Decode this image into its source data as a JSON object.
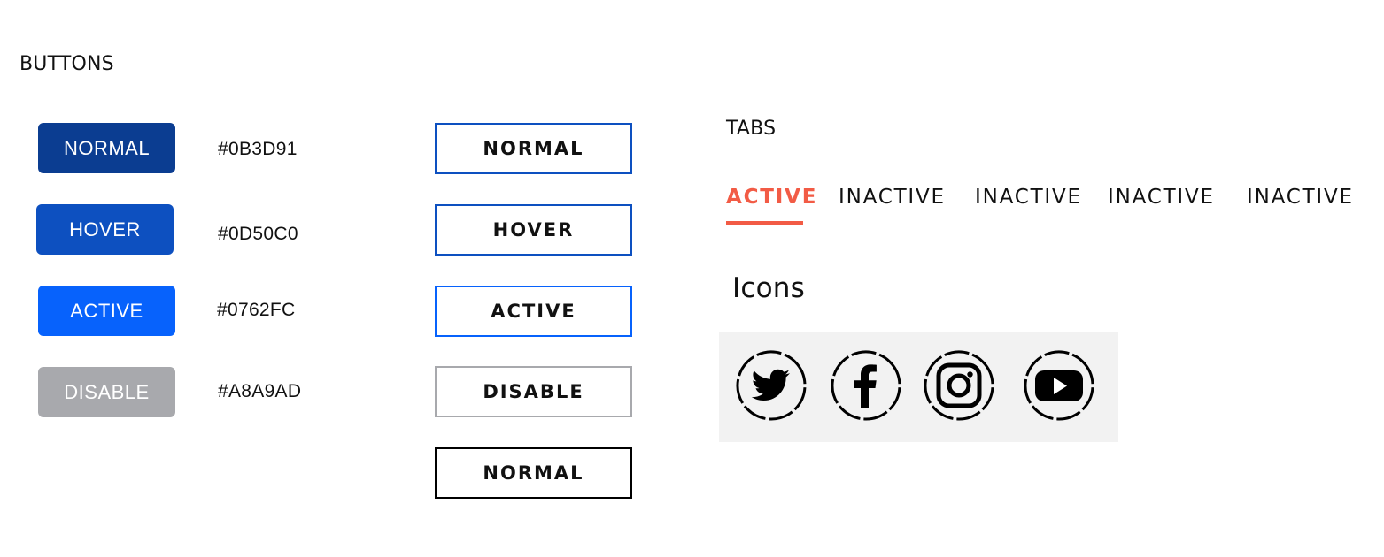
{
  "buttons_section": {
    "title": "BUTTONS",
    "filled_buttons": [
      {
        "label": "NORMAL",
        "color": "#0B3D91",
        "hex_label": "#0B3D91"
      },
      {
        "label": "HOVER",
        "color": "#0D50C0",
        "hex_label": "#0D50C0"
      },
      {
        "label": "ACTIVE",
        "color": "#0762FC",
        "hex_label": "#0762FC"
      },
      {
        "label": "DISABLE",
        "color": "#A8A9AD",
        "hex_label": "#A8A9AD"
      }
    ],
    "outline_buttons": [
      {
        "label": "NORMAL",
        "border_color": "#0D50C0"
      },
      {
        "label": "HOVER",
        "border_color": "#0D50C0"
      },
      {
        "label": "ACTIVE",
        "border_color": "#0762FC"
      },
      {
        "label": "DISABLE",
        "border_color": "#A8A9AD"
      },
      {
        "label": "NORMAL",
        "border_color": "#000000"
      }
    ]
  },
  "tabs_section": {
    "title": "TABS",
    "accent_color": "#F25B45",
    "tabs": [
      {
        "label": "ACTIVE",
        "active": true
      },
      {
        "label": "INACTIVE",
        "active": false
      },
      {
        "label": "INACTIVE",
        "active": false
      },
      {
        "label": "INACTIVE",
        "active": false
      },
      {
        "label": "INACTIVE",
        "active": false
      }
    ]
  },
  "icons_section": {
    "title": "Icons",
    "icons": [
      "twitter-icon",
      "facebook-icon",
      "instagram-icon",
      "youtube-icon"
    ]
  }
}
